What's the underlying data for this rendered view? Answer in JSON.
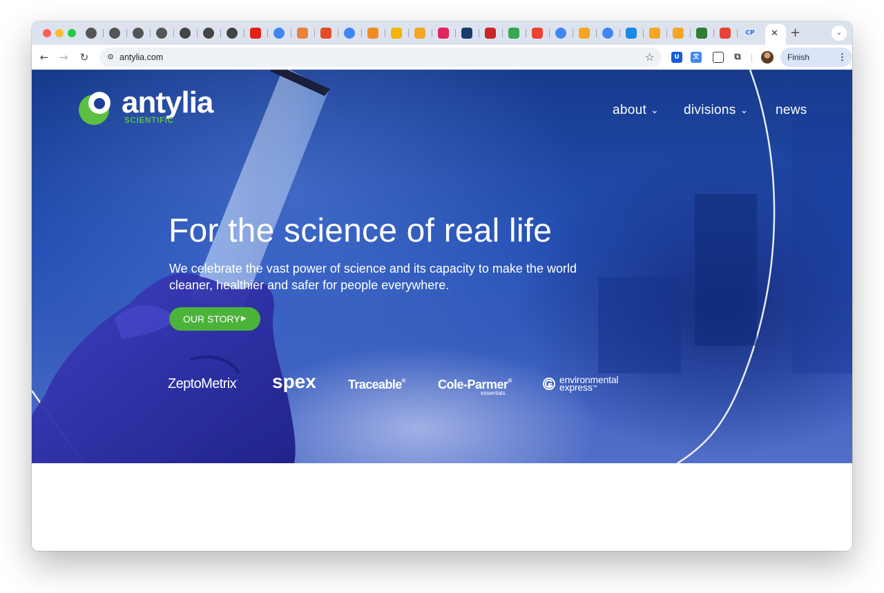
{
  "browser": {
    "tab_favicons": [
      {
        "icon": "openai-icon",
        "color": "#555555"
      },
      {
        "icon": "openai-icon",
        "color": "#555555"
      },
      {
        "icon": "openai-icon",
        "color": "#555555"
      },
      {
        "icon": "openai-icon",
        "color": "#555555"
      },
      {
        "icon": "globe-icon",
        "color": "#444444"
      },
      {
        "icon": "globe-icon",
        "color": "#444444"
      },
      {
        "icon": "globe-icon",
        "color": "#444444"
      },
      {
        "icon": "youtube-icon",
        "color": "#e62117"
      },
      {
        "icon": "google-icon",
        "color": "#4285f4"
      },
      {
        "icon": "tool-icon",
        "color": "#e8833a"
      },
      {
        "icon": "joomla-icon",
        "color": "#e44d26"
      },
      {
        "icon": "google-icon",
        "color": "#4285f4"
      },
      {
        "icon": "orange-circle-icon",
        "color": "#f08a24"
      },
      {
        "icon": "yellow-tag-icon",
        "color": "#f4b400"
      },
      {
        "icon": "orange-x-icon",
        "color": "#f5a623"
      },
      {
        "icon": "target-icon",
        "color": "#e0245e"
      },
      {
        "icon": "marketo-icon",
        "color": "#1b3a6b"
      },
      {
        "icon": "flag-icon",
        "color": "#c62828"
      },
      {
        "icon": "green-leaf-icon",
        "color": "#34a853"
      },
      {
        "icon": "gmail-icon",
        "color": "#ea4335"
      },
      {
        "icon": "google-icon",
        "color": "#4285f4"
      },
      {
        "icon": "orange-x-icon",
        "color": "#f5a623"
      },
      {
        "icon": "google-icon",
        "color": "#4285f4"
      },
      {
        "icon": "shield-icon",
        "color": "#1e88e5"
      },
      {
        "icon": "orange-x-icon",
        "color": "#f5a623"
      },
      {
        "icon": "orange-x-icon",
        "color": "#f5a623"
      },
      {
        "icon": "checkmark-icon",
        "color": "#2e7d32"
      },
      {
        "icon": "gmail-icon",
        "color": "#ea4335"
      },
      {
        "icon": "cp-icon",
        "color": "#1a73e8"
      }
    ],
    "cp_label": "CP",
    "url": "antylia.com",
    "finish_update_label": "Finish update",
    "new_tab_glyph": "+"
  },
  "site": {
    "logo": {
      "wordmark": "antylia",
      "subtitle": "SCIENTIFIC"
    },
    "nav": [
      {
        "label": "about",
        "has_dropdown": true
      },
      {
        "label": "divisions",
        "has_dropdown": true
      },
      {
        "label": "news",
        "has_dropdown": false
      }
    ],
    "hero": {
      "headline": "For the science of real life",
      "subline": "We celebrate the vast power of science and its capacity to make the world cleaner, healthier and safer for people everywhere.",
      "cta_label": "OUR STORY"
    },
    "brands": {
      "zeptometrix": "ZeptoMetrix",
      "zeptometrix_mark": "·",
      "spex": "spex",
      "traceable": "Traceable",
      "traceable_mark": "®",
      "cole_parmer": "Cole-Parmer",
      "cole_parmer_mark": "®",
      "cole_parmer_sub": "essentials",
      "env_line1": "environmental",
      "env_line2": "express",
      "env_mark": "™"
    },
    "colors": {
      "brand_green": "#4cb33a",
      "hero_blue": "#2450b4"
    }
  }
}
